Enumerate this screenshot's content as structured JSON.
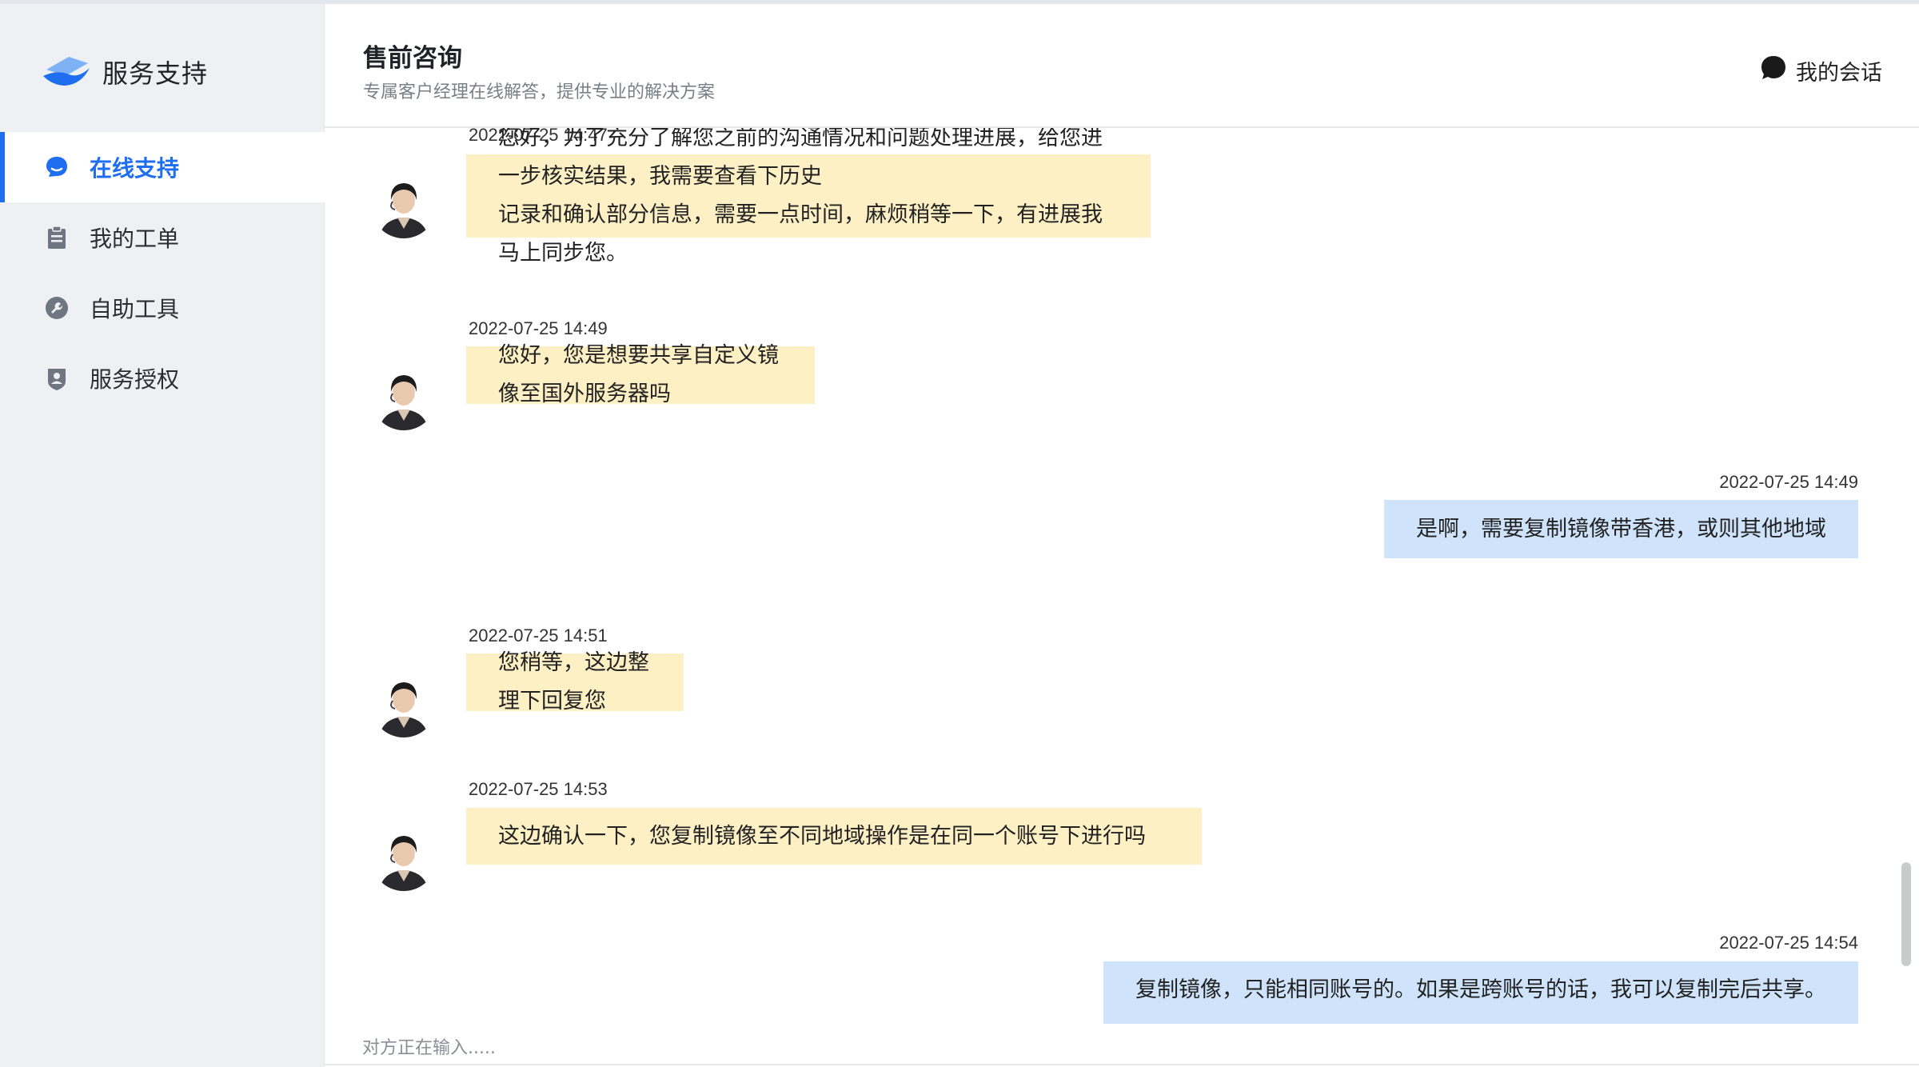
{
  "sidebar": {
    "brand_title": "服务支持",
    "items": [
      {
        "label": "在线支持",
        "icon": "chat-bubble-icon",
        "active": true
      },
      {
        "label": "我的工单",
        "icon": "clipboard-icon",
        "active": false
      },
      {
        "label": "自助工具",
        "icon": "wrench-icon",
        "active": false
      },
      {
        "label": "服务授权",
        "icon": "badge-user-icon",
        "active": false
      }
    ]
  },
  "header": {
    "title": "售前咨询",
    "subtitle": "专属客户经理在线解答，提供专业的解决方案",
    "my_session": "我的会话"
  },
  "messages": [
    {
      "sender": "agent",
      "time": "2022-07-25 14:47",
      "lines": [
        "您好，为了充分了解您之前的沟通情况和问题处理进展，给您进一步核实结果，我需要查看下历史",
        "记录和确认部分信息，需要一点时间，麻烦稍等一下，有进展我马上同步您。"
      ]
    },
    {
      "sender": "agent",
      "time": "2022-07-25 14:49",
      "lines": [
        "您好，您是想要共享自定义镜像至国外服务器吗"
      ]
    },
    {
      "sender": "user",
      "time": "2022-07-25 14:49",
      "lines": [
        "是啊，需要复制镜像带香港，或则其他地域"
      ]
    },
    {
      "sender": "agent",
      "time": "2022-07-25 14:51",
      "lines": [
        "您稍等，这边整理下回复您"
      ]
    },
    {
      "sender": "agent",
      "time": "2022-07-25 14:53",
      "lines": [
        "这边确认一下，您复制镜像至不同地域操作是在同一个账号下进行吗"
      ]
    },
    {
      "sender": "user",
      "time": "2022-07-25 14:54",
      "lines": [
        "复制镜像，只能相同账号的。如果是跨账号的话，我可以复制完后共享。"
      ]
    }
  ],
  "status": {
    "typing": "对方正在输入....."
  },
  "colors": {
    "accent": "#1f6ef0",
    "agent_bubble": "#fdf0c4",
    "user_bubble": "#cfe3fb",
    "sidebar_bg": "#eef0f4"
  }
}
